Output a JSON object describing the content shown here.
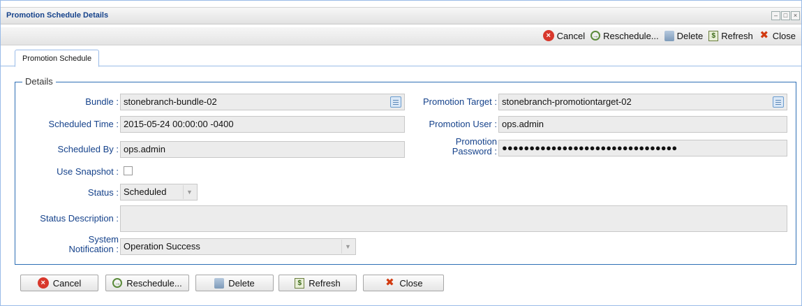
{
  "window": {
    "title": "Promotion Schedule Details",
    "controls": [
      "minimize",
      "maximize",
      "close"
    ]
  },
  "toolbar": {
    "cancel": "Cancel",
    "reschedule": "Reschedule...",
    "delete": "Delete",
    "refresh": "Refresh",
    "close": "Close"
  },
  "tabs": [
    {
      "label": "Promotion Schedule",
      "active": true
    }
  ],
  "details": {
    "legend": "Details",
    "bundle": {
      "label": "Bundle :",
      "value": "stonebranch-bundle-02"
    },
    "scheduled_time": {
      "label": "Scheduled Time :",
      "value": "2015-05-24 00:00:00 -0400"
    },
    "scheduled_by": {
      "label": "Scheduled By :",
      "value": "ops.admin"
    },
    "use_snapshot": {
      "label": "Use Snapshot :",
      "checked": false
    },
    "status": {
      "label": "Status :",
      "value": "Scheduled"
    },
    "status_description": {
      "label": "Status Description :",
      "value": ""
    },
    "system_notification": {
      "label_line1": "System",
      "label_line2": "Notification :",
      "value": "Operation Success"
    },
    "promotion_target": {
      "label": "Promotion Target :",
      "value": "stonebranch-promotiontarget-02"
    },
    "promotion_user": {
      "label": "Promotion User :",
      "value": "ops.admin"
    },
    "promotion_password": {
      "label_line1": "Promotion",
      "label_line2": "Password :",
      "value": "●●●●●●●●●●●●●●●●●●●●●●●●●●●●●●●●"
    }
  },
  "buttons": {
    "cancel": "Cancel",
    "reschedule": "Reschedule...",
    "delete": "Delete",
    "refresh": "Refresh",
    "close": "Close"
  },
  "icons": {
    "cancel": "cancel-icon",
    "reschedule": "reschedule-icon",
    "delete": "delete-icon",
    "refresh": "refresh-icon",
    "close": "close-icon",
    "lookup": "lookup-icon"
  },
  "colors": {
    "label": "#15428b",
    "fieldset_border": "#2e6fb5",
    "cancel_red": "#d8382c",
    "close_orange": "#d23a10"
  }
}
